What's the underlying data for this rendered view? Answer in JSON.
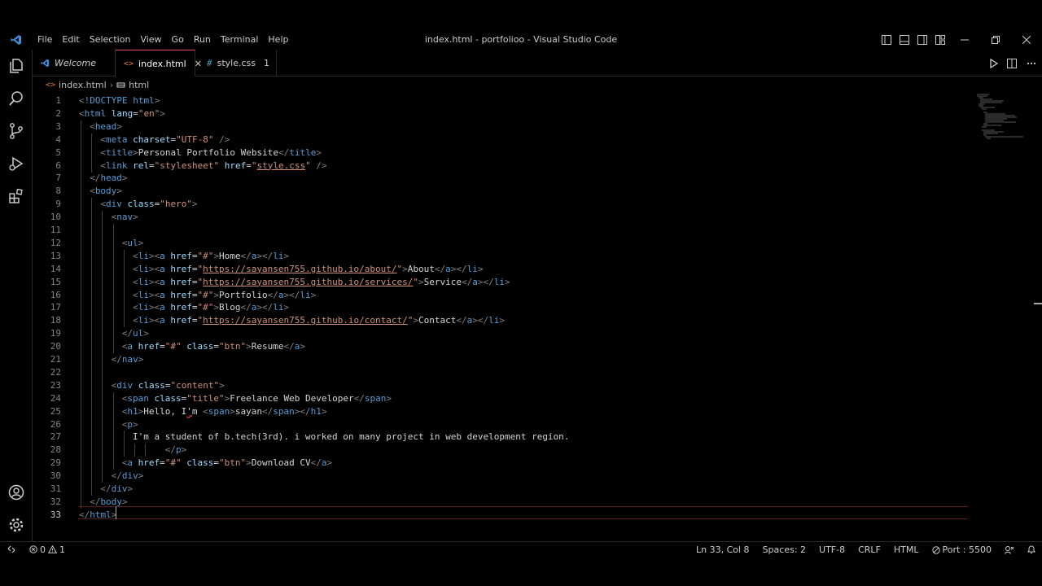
{
  "window": {
    "title": "index.html - portfolioo - Visual Studio Code"
  },
  "menu": [
    "File",
    "Edit",
    "Selection",
    "View",
    "Go",
    "Run",
    "Terminal",
    "Help"
  ],
  "tabs": [
    {
      "label": "Welcome",
      "icon": "vscode-icon"
    },
    {
      "label": "index.html",
      "icon": "html-file-icon",
      "icon_text": "<>",
      "close": "✕"
    },
    {
      "label": "style.css",
      "icon": "css-file-icon",
      "icon_text": "#",
      "badge": "1"
    }
  ],
  "breadcrumb": {
    "file": "index.html",
    "symbol": "html",
    "file_icon": "<>",
    "sep": "›"
  },
  "editor": {
    "active_line": 33,
    "lines": [
      {
        "n": "1"
      },
      {
        "n": "2"
      },
      {
        "n": "3"
      },
      {
        "n": "4"
      },
      {
        "n": "5"
      },
      {
        "n": "6"
      },
      {
        "n": "7"
      },
      {
        "n": "8"
      },
      {
        "n": "9"
      },
      {
        "n": "10"
      },
      {
        "n": "11"
      },
      {
        "n": "12"
      },
      {
        "n": "13"
      },
      {
        "n": "14"
      },
      {
        "n": "15"
      },
      {
        "n": "16"
      },
      {
        "n": "17"
      },
      {
        "n": "18"
      },
      {
        "n": "19"
      },
      {
        "n": "20"
      },
      {
        "n": "21"
      },
      {
        "n": "22"
      },
      {
        "n": "23"
      },
      {
        "n": "24"
      },
      {
        "n": "25"
      },
      {
        "n": "26"
      },
      {
        "n": "27"
      },
      {
        "n": "28"
      },
      {
        "n": "29"
      },
      {
        "n": "30"
      },
      {
        "n": "31"
      },
      {
        "n": "32"
      },
      {
        "n": "33"
      }
    ],
    "code": {
      "l1_doctype": "!DOCTYPE",
      "l1_html": "html",
      "html": "html",
      "lang": "lang",
      "en": "\"en\"",
      "head": "head",
      "meta": "meta",
      "charset": "charset",
      "utf8": "\"UTF-8\"",
      "title": "title",
      "title_text": "Personal Portfolio Website",
      "link": "link",
      "rel": "rel",
      "stylesheet": "\"stylesheet\"",
      "href": "href",
      "style_css": "style.css",
      "body": "body",
      "div": "div",
      "class": "class",
      "hero": "\"hero\"",
      "nav": "nav",
      "ul": "ul",
      "li": "li",
      "a": "a",
      "hash": "\"#\"",
      "home": "Home",
      "about_url": "https://sayansen755.github.io/about/",
      "about": "About",
      "services_url": "https://sayansen755.github.io/services/",
      "service": "Service",
      "portfolio": "Portfolio",
      "blog": "Blog",
      "contact_url": "https://sayansen755.github.io/contact/",
      "contact": "Contact",
      "btn": "\"btn\"",
      "resume": "Resume",
      "content": "\"content\"",
      "span": "span",
      "title_cls": "\"title\"",
      "freelance": "Freelance Web Developer",
      "h1": "h1",
      "hello_a": "Hello, I",
      "hello_b": "'",
      "hello_c": "m ",
      "sayan": "sayan",
      "p": "p",
      "para": "I'm a student of b.tech(3rd). i worked on many project in web development region.",
      "download": "Download CV"
    }
  },
  "status": {
    "errors": "0",
    "warnings": "1",
    "position": "Ln 33, Col 8",
    "spaces": "Spaces: 2",
    "encoding": "UTF-8",
    "eol": "CRLF",
    "language": "HTML",
    "port": "Port : 5500"
  },
  "colors": {
    "accent": "#e05050",
    "tag": "#569cd6",
    "attr": "#9cdcfe",
    "string": "#ce9178",
    "bracket": "#808080",
    "vscode_blue": "#3c8cd8"
  }
}
